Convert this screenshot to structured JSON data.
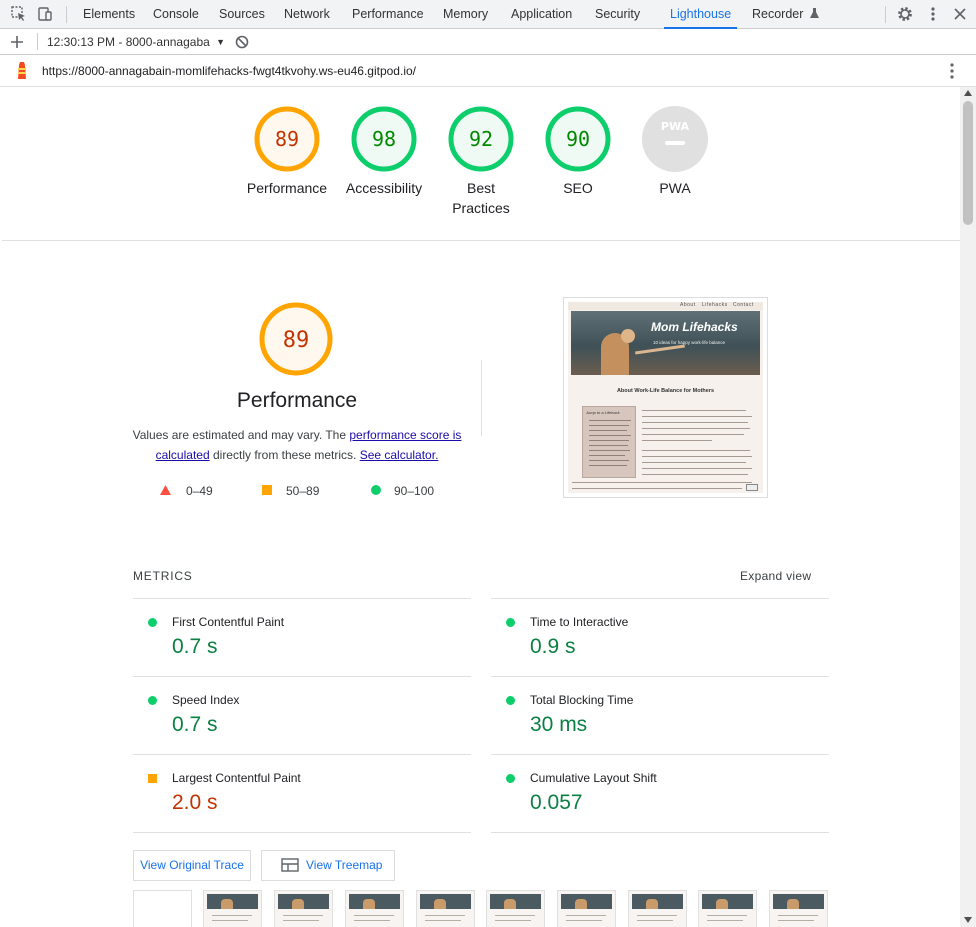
{
  "devtools": {
    "tabs": [
      "Elements",
      "Console",
      "Sources",
      "Network",
      "Performance",
      "Memory",
      "Application",
      "Security",
      "Lighthouse",
      "Recorder"
    ],
    "active_tab": "Lighthouse"
  },
  "report_bar": {
    "report_label": "12:30:13 PM - 8000-annagaba"
  },
  "url_bar": {
    "url": "https://8000-annagabain-momlifehacks-fwgt4tkvohy.ws-eu46.gitpod.io/"
  },
  "summary_gauges": [
    {
      "score": "89",
      "label": "Performance",
      "rating": "average"
    },
    {
      "score": "98",
      "label": "Accessibility",
      "rating": "pass"
    },
    {
      "score": "92",
      "label": "Best Practices",
      "rating": "pass"
    },
    {
      "score": "90",
      "label": "SEO",
      "rating": "pass"
    },
    {
      "score": "",
      "label": "PWA",
      "rating": "na",
      "badge": "PWA"
    }
  ],
  "performance": {
    "score": "89",
    "title": "Performance",
    "desc_1": "Values are estimated and may vary. The ",
    "link_score": "performance score is calculated",
    "desc_2": " directly from these metrics. ",
    "link_calc": "See calculator.",
    "legend": [
      {
        "range": "0–49",
        "shape": "triangle",
        "color": "#ff4e42"
      },
      {
        "range": "50–89",
        "shape": "square",
        "color": "#ffa400"
      },
      {
        "range": "90–100",
        "shape": "circle",
        "color": "#0cce6b"
      }
    ]
  },
  "screenshot": {
    "nav": [
      "About",
      "Lifehacks",
      "Contact"
    ],
    "title": "Mom Lifehacks",
    "subtitle": "10 ideas for happy work-life balance",
    "heading": "About Work-Life Balance for Mothers",
    "sidebar_title": "Jump to a Lifehack"
  },
  "metrics": {
    "heading": "METRICS",
    "expand": "Expand view",
    "items": [
      {
        "name": "First Contentful Paint",
        "value": "0.7 s",
        "rating": "pass"
      },
      {
        "name": "Time to Interactive",
        "value": "0.9 s",
        "rating": "pass"
      },
      {
        "name": "Speed Index",
        "value": "0.7 s",
        "rating": "pass"
      },
      {
        "name": "Total Blocking Time",
        "value": "30 ms",
        "rating": "pass"
      },
      {
        "name": "Largest Contentful Paint",
        "value": "2.0 s",
        "rating": "average"
      },
      {
        "name": "Cumulative Layout Shift",
        "value": "0.057",
        "rating": "pass"
      }
    ]
  },
  "buttons": {
    "trace": "View Original Trace",
    "treemap": "View Treemap"
  },
  "colors": {
    "pass": "#0cce6b",
    "average": "#ffa400",
    "fail": "#ff4e42",
    "link": "#1a73e8"
  }
}
